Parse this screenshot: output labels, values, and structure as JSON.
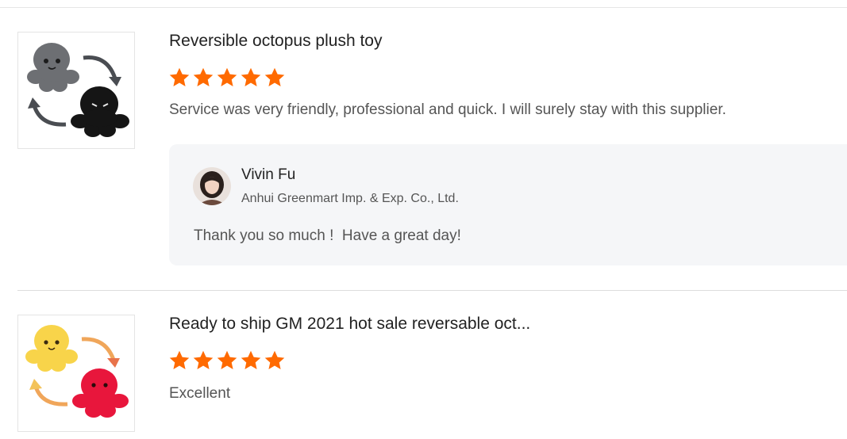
{
  "reviews": [
    {
      "product_title": "Reversible octopus plush toy",
      "rating": 5,
      "rating_max": 5,
      "comment": "Service was very friendly, professional and quick. I will surely stay with this supplier.",
      "thumbnail_icon": "octopus-plush-gray-black",
      "reply": {
        "name": "Vivin Fu",
        "company": "Anhui Greenmart Imp. & Exp. Co., Ltd.",
        "text": "Thank you so much !  Have a great day!"
      }
    },
    {
      "product_title": "Ready to ship GM 2021 hot sale reversable oct...",
      "rating": 5,
      "rating_max": 5,
      "comment": "Excellent",
      "thumbnail_icon": "octopus-plush-yellow-red"
    }
  ],
  "colors": {
    "star": "#ff6a00",
    "reply_background": "#f5f6f8",
    "divider": "#dddddd"
  }
}
